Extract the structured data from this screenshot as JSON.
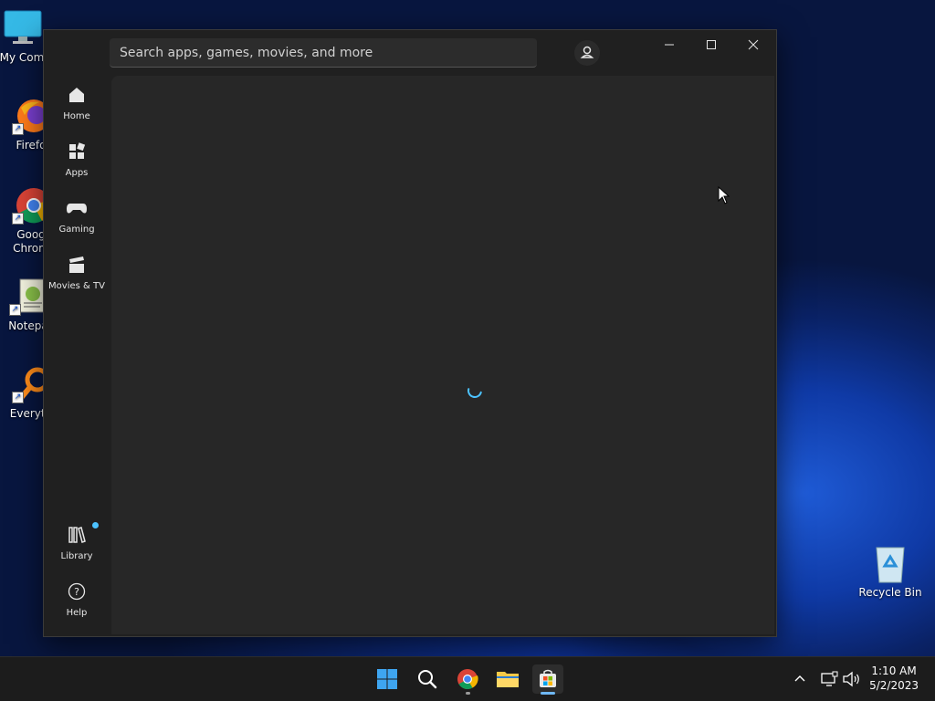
{
  "desktop": {
    "icons": [
      {
        "label": "My Com",
        "icon": "computer-icon"
      },
      {
        "label": "Firefo",
        "icon": "firefox-icon"
      },
      {
        "label": "Goog Chrom",
        "label_line1": "Goog",
        "label_line2": "Chrom",
        "icon": "chrome-icon"
      },
      {
        "label": "Notepa",
        "icon": "notepad-icon"
      },
      {
        "label": "Everyth",
        "icon": "everything-search-icon"
      },
      {
        "label": "Recycle Bin",
        "icon": "recycle-bin-icon"
      }
    ]
  },
  "store": {
    "search": {
      "placeholder": "Search apps, games, movies, and more",
      "value": ""
    },
    "nav": [
      {
        "label": "Home",
        "icon": "home-icon"
      },
      {
        "label": "Apps",
        "icon": "apps-icon"
      },
      {
        "label": "Gaming",
        "icon": "gamepad-icon"
      },
      {
        "label": "Movies & TV",
        "icon": "clapperboard-icon"
      }
    ],
    "nav_bottom": [
      {
        "label": "Library",
        "icon": "library-icon",
        "badge": true
      },
      {
        "label": "Help",
        "icon": "help-icon"
      }
    ],
    "window_controls": [
      "minimize",
      "maximize",
      "close"
    ],
    "accent_color": "#4cc2ff",
    "loading": true
  },
  "taskbar": {
    "apps": [
      {
        "name": "start",
        "icon": "windows-start-icon"
      },
      {
        "name": "search",
        "icon": "search-icon"
      },
      {
        "name": "chrome",
        "icon": "chrome-icon",
        "running": true
      },
      {
        "name": "file-explorer",
        "icon": "folder-icon"
      },
      {
        "name": "microsoft-store",
        "icon": "store-icon",
        "active": true
      }
    ],
    "clock": {
      "time": "1:10 AM",
      "date": "5/2/2023"
    }
  }
}
